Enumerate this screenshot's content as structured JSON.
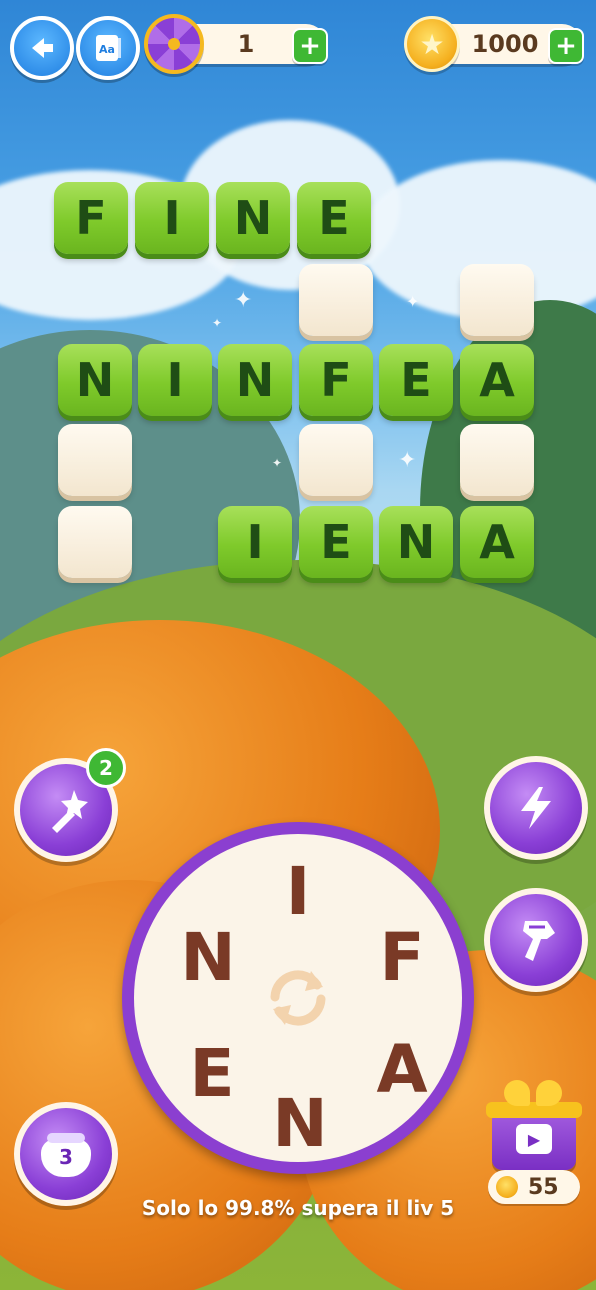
{
  "header": {
    "spin_count": "1",
    "coins": "1000",
    "back_icon": "back-arrow-icon",
    "dictionary_icon": "dictionary-icon",
    "spin_icon": "prize-wheel-icon",
    "coin_icon": "gold-coin-icon"
  },
  "board": {
    "words": [
      "FINE",
      "NINFEA",
      "IENA"
    ],
    "rows": [
      {
        "letters": [
          "F",
          "I",
          "N",
          "E"
        ]
      },
      {
        "letters": [
          "N",
          "I",
          "N",
          "F",
          "E",
          "A"
        ]
      },
      {
        "letters": [
          "I",
          "E",
          "N",
          "A"
        ]
      }
    ]
  },
  "boosters": {
    "hint_badge": "2",
    "magic_wand_icon": "magic-wand-icon",
    "lightning_icon": "lightning-icon",
    "hammer_icon": "hammer-icon",
    "pot_count": "3",
    "pot_icon": "pot-icon"
  },
  "wheel": {
    "letters": [
      "I",
      "F",
      "A",
      "N",
      "E",
      "N"
    ],
    "shuffle_icon": "shuffle-icon"
  },
  "gift": {
    "coins": "55",
    "video_icon": "video-play-icon"
  },
  "footer": {
    "progress_text": "Solo lo 99.8% supera il liv 5"
  },
  "colors": {
    "tile_green": "#7fca2b",
    "tile_text": "#1f4d15",
    "wheel_purple": "#8b3fd0",
    "letter_brown": "#7a3a26"
  }
}
